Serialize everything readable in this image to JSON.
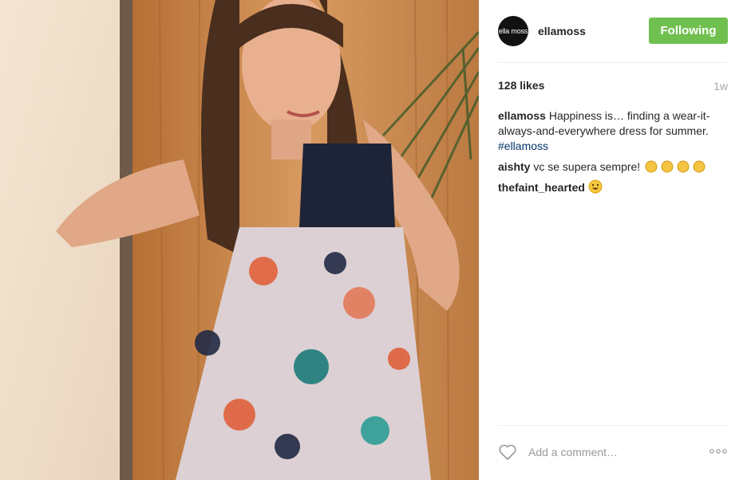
{
  "post": {
    "username": "ellamoss",
    "avatar_text": "ella moss",
    "follow_label": "Following",
    "likes": "128 likes",
    "age": "1w",
    "caption": {
      "author": "ellamoss",
      "text": " Happiness is… finding a wear-it-always-and-everywhere dress for summer. ",
      "hashtag": "#ellamoss"
    },
    "comments": [
      {
        "author": "aishty",
        "text": " vc se supera sempre!",
        "emoji": "clapping-hands x4"
      },
      {
        "author": "thefaint_hearted",
        "text": " ",
        "emoji": "smiling-face"
      }
    ],
    "comment_placeholder": "Add a comment…",
    "icons": {
      "like": "heart-outline-icon",
      "more": "more-options-icon"
    },
    "colors": {
      "follow_button": "#70c050",
      "hashtag": "#003569"
    }
  }
}
